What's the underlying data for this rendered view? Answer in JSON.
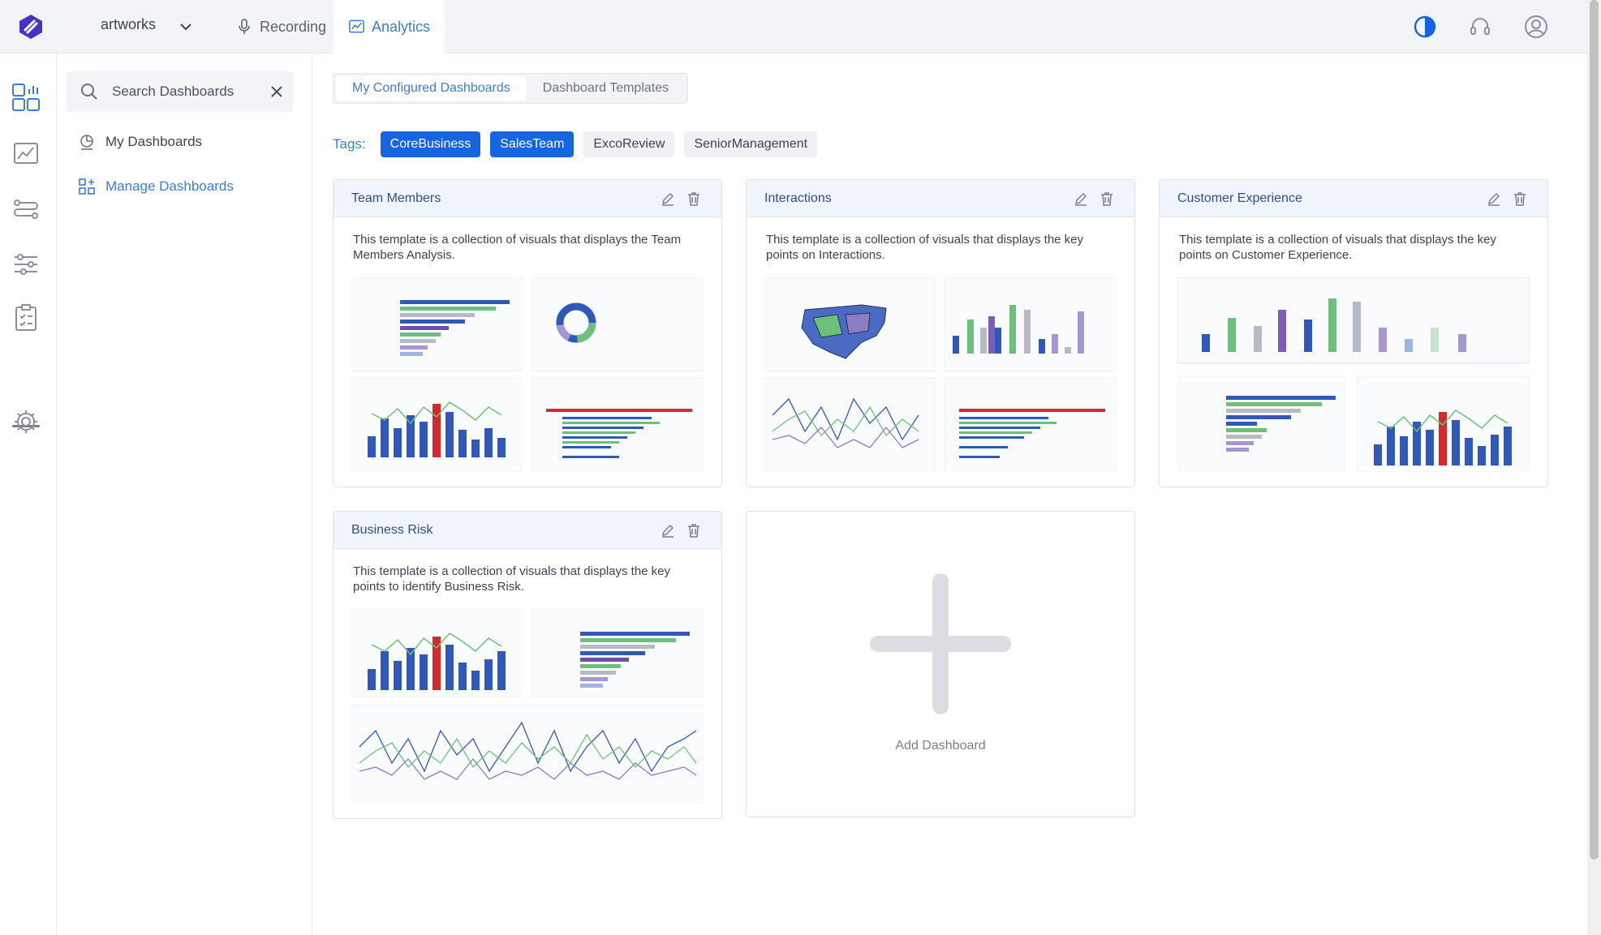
{
  "topbar": {
    "workspace": "artworks",
    "tabs": [
      {
        "label": "Recording",
        "icon": "microphone-icon"
      },
      {
        "label": "Analytics",
        "icon": "analytics-icon",
        "active": true
      }
    ],
    "accent": "#3e7bd6"
  },
  "side": {
    "search": {
      "placeholder": "Search Dashboards",
      "value": ""
    },
    "items": [
      {
        "label": "My Dashboards",
        "icon": "pie-chart-icon"
      },
      {
        "label": "Manage Dashboards",
        "icon": "grid-add-icon",
        "active": true
      }
    ]
  },
  "main": {
    "segments": [
      "My Configured Dashboards",
      "Dashboard Templates"
    ],
    "tags_label": "Tags:",
    "tags": [
      {
        "label": "CoreBusiness",
        "selected": true
      },
      {
        "label": "SalesTeam",
        "selected": true
      },
      {
        "label": "ExcoReview",
        "selected": false
      },
      {
        "label": "SeniorManagement",
        "selected": false
      }
    ],
    "cards": [
      {
        "title": "Team Members",
        "desc": "This template is a collection of visuals that displays the Team Members Analysis."
      },
      {
        "title": "Interactions",
        "desc": "This template is a collection of visuals that displays the key points on Interactions."
      },
      {
        "title": "Customer Experience",
        "desc": "This template is a collection of visuals that displays the key points on Customer Experience."
      },
      {
        "title": "Business Risk",
        "desc": "This template is a collection of visuals that displays the key points to identify Business Risk."
      }
    ],
    "add_label": "Add Dashboard"
  }
}
